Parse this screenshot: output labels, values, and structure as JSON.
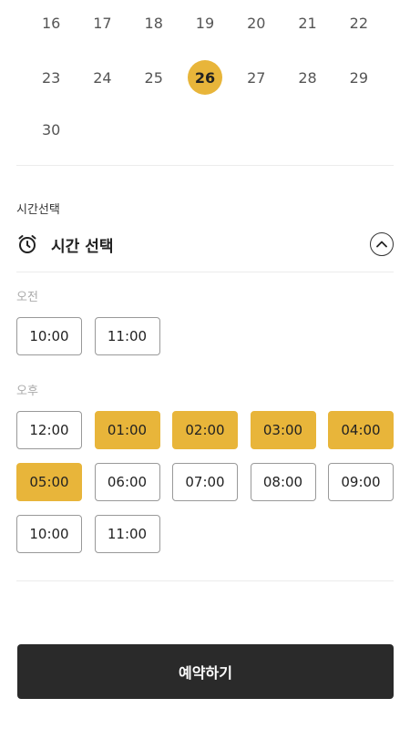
{
  "calendar": {
    "rows": [
      [
        "16",
        "17",
        "18",
        "19",
        "20",
        "21",
        "22"
      ],
      [
        "23",
        "24",
        "25",
        "26",
        "27",
        "28",
        "29"
      ],
      [
        "30"
      ]
    ],
    "selected_day": "26"
  },
  "time_section": {
    "caption": "시간선택",
    "title": "시간 선택",
    "icons": {
      "clock": "alarm-clock-icon",
      "toggle": "chevron-up-icon"
    },
    "am_label": "오전",
    "pm_label": "오후",
    "am_slots": [
      {
        "label": "10:00",
        "selected": false
      },
      {
        "label": "11:00",
        "selected": false
      }
    ],
    "pm_slots": [
      {
        "label": "12:00",
        "selected": false
      },
      {
        "label": "01:00",
        "selected": true
      },
      {
        "label": "02:00",
        "selected": true
      },
      {
        "label": "03:00",
        "selected": true
      },
      {
        "label": "04:00",
        "selected": true
      },
      {
        "label": "05:00",
        "selected": true
      },
      {
        "label": "06:00",
        "selected": false
      },
      {
        "label": "07:00",
        "selected": false
      },
      {
        "label": "08:00",
        "selected": false
      },
      {
        "label": "09:00",
        "selected": false
      },
      {
        "label": "10:00",
        "selected": false
      },
      {
        "label": "11:00",
        "selected": false
      }
    ]
  },
  "reserve_button": {
    "label": "예약하기"
  },
  "colors": {
    "accent": "#e8b53a",
    "button_dark": "#2a2a2a"
  }
}
